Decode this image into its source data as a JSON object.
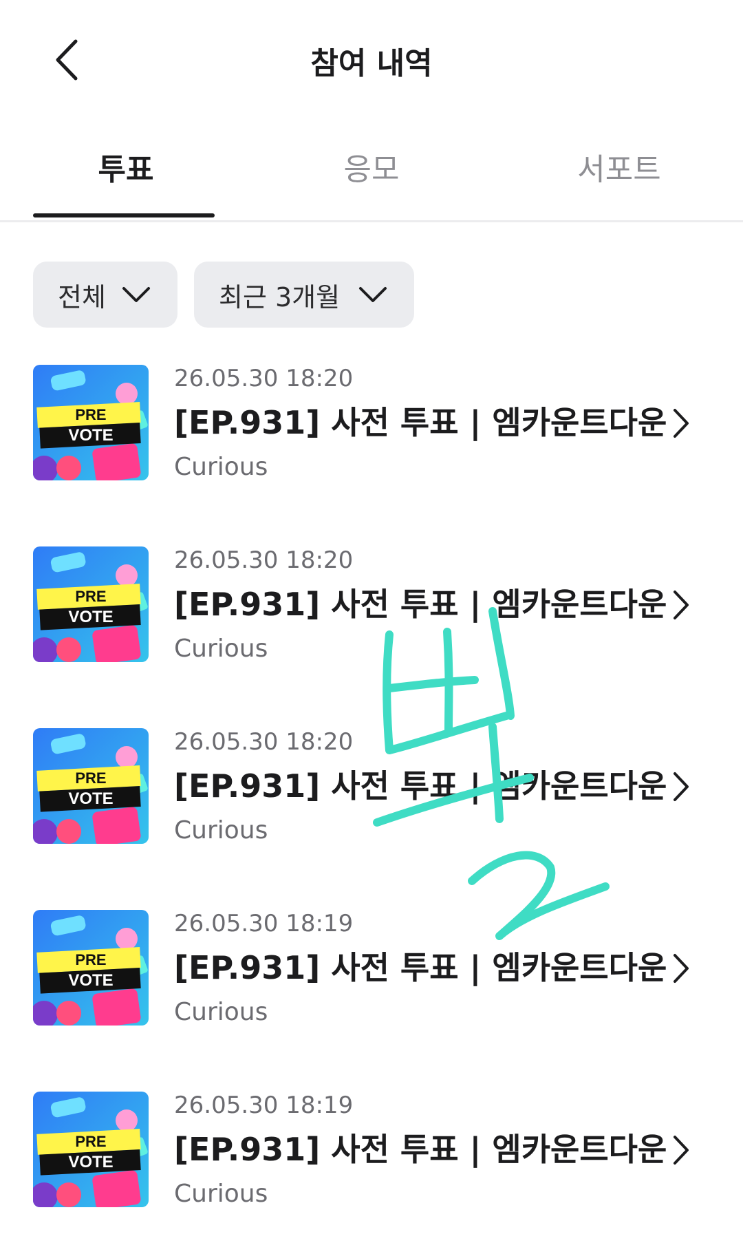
{
  "header": {
    "title": "참여 내역",
    "back_icon": "chevron-left-icon"
  },
  "tabs": [
    {
      "label": "투표",
      "active": true
    },
    {
      "label": "응모",
      "active": false
    },
    {
      "label": "서포트",
      "active": false
    }
  ],
  "filters": [
    {
      "label": "전체",
      "icon": "chevron-down-icon"
    },
    {
      "label": "최근 3개월",
      "icon": "chevron-down-icon"
    }
  ],
  "items": [
    {
      "date": "26.05.30 18:20",
      "title": "[EP.931] 사전 투표 | 엠카운트다운",
      "subtitle": "Curious",
      "thumb_text_1": "PRE",
      "thumb_text_2": "VOTE"
    },
    {
      "date": "26.05.30 18:20",
      "title": "[EP.931] 사전 투표 | 엠카운트다운",
      "subtitle": "Curious",
      "thumb_text_1": "PRE",
      "thumb_text_2": "VOTE"
    },
    {
      "date": "26.05.30 18:20",
      "title": "[EP.931] 사전 투표 | 엠카운트다운",
      "subtitle": "Curious",
      "thumb_text_1": "PRE",
      "thumb_text_2": "VOTE"
    },
    {
      "date": "26.05.30 18:19",
      "title": "[EP.931] 사전 투표 | 엠카운트다운",
      "subtitle": "Curious",
      "thumb_text_1": "PRE",
      "thumb_text_2": "VOTE"
    },
    {
      "date": "26.05.30 18:19",
      "title": "[EP.931] 사전 투표 | 엠카운트다운",
      "subtitle": "Curious",
      "thumb_text_1": "PRE",
      "thumb_text_2": "VOTE"
    }
  ],
  "colors": {
    "accent": "#1c1c1e",
    "muted": "#8e8e93",
    "chip_bg": "#ebecef",
    "scribble": "#3fdcc4"
  }
}
